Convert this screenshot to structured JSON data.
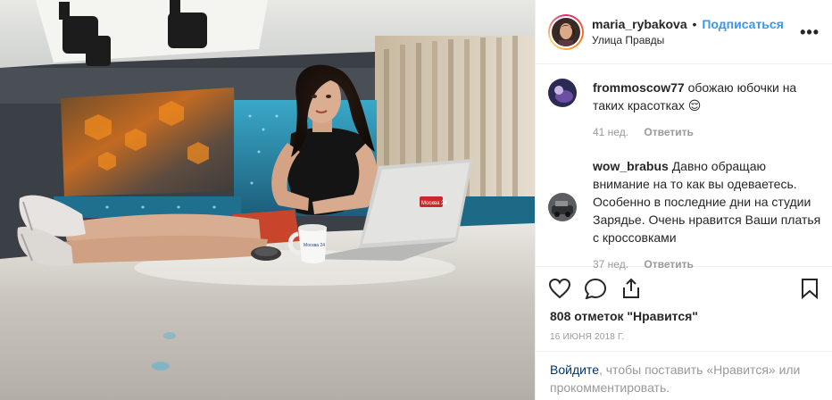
{
  "post": {
    "username": "maria_rybakova",
    "separator": "•",
    "follow_label": "Подписаться",
    "location": "Улица Правды",
    "more_label": "•••"
  },
  "comments": [
    {
      "username": "frommoscow77",
      "text": "обожаю юбочки на таких красотках 😌",
      "age": "41 нед.",
      "reply_label": "Ответить"
    },
    {
      "username": "wow_brabus",
      "text": "Давно обращаю внимание на то как вы одеваетесь. Особенно в последние дни на студии Зарядье. Очень нравится Ваши платья с кроссовками",
      "age": "37 нед.",
      "reply_label": "Ответить"
    }
  ],
  "icons": {
    "like": "heart-icon",
    "comment": "comment-icon",
    "share": "share-icon",
    "save": "bookmark-icon"
  },
  "likes_text": "808 отметок \"Нравится\"",
  "date_text": "16 июня 2018 г.",
  "login_prompt": {
    "link": "Войдите",
    "text": ", чтобы поставить «Нравится» или прокомментировать."
  },
  "photo": {
    "mug_text": "Москва 24",
    "laptop_text": "Москва 24"
  },
  "colors": {
    "link_blue": "#3897f0",
    "muted": "#999999",
    "border": "#efefef",
    "login_link": "#003569"
  }
}
